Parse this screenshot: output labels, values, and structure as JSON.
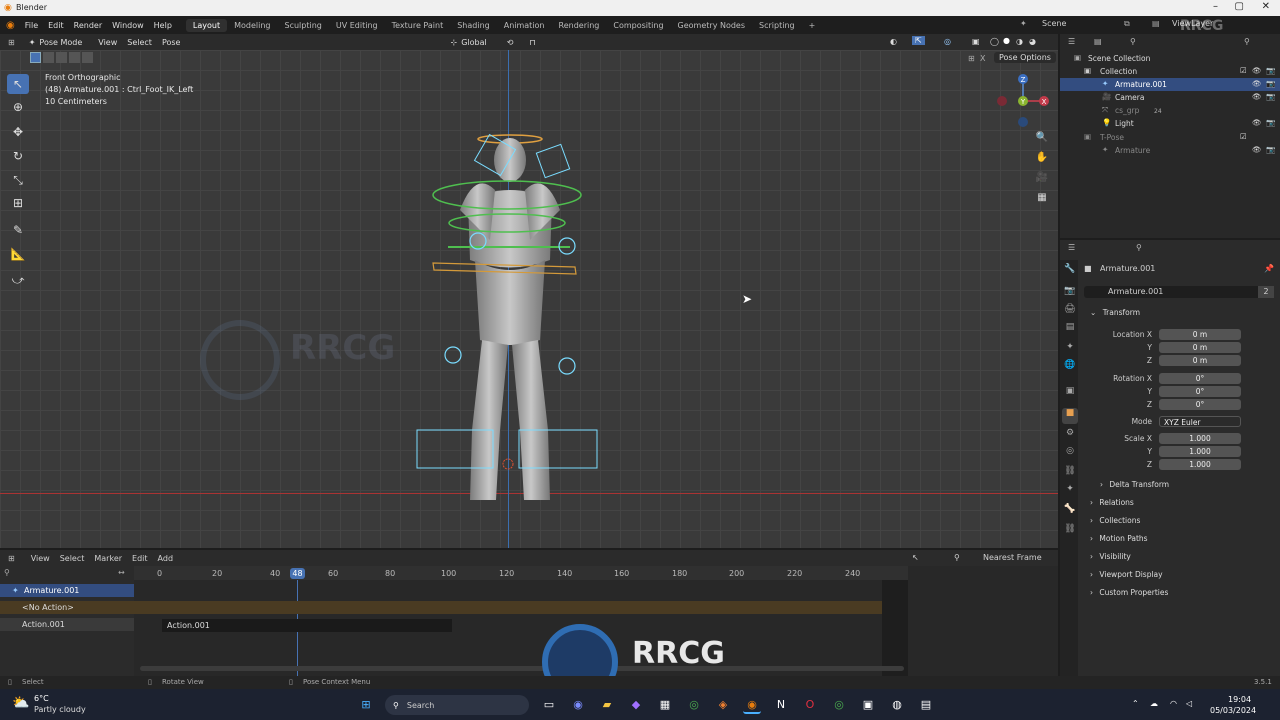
{
  "window": {
    "title": "Blender"
  },
  "menu": {
    "items": [
      "File",
      "Edit",
      "Render",
      "Window",
      "Help"
    ]
  },
  "workspaces": [
    "Layout",
    "Modeling",
    "Sculpting",
    "UV Editing",
    "Texture Paint",
    "Shading",
    "Animation",
    "Rendering",
    "Compositing",
    "Geometry Nodes",
    "Scripting"
  ],
  "workspace_add": "+",
  "scene": {
    "name": "Scene",
    "view_layer": "ViewLayer"
  },
  "viewport": {
    "mode": "Pose Mode",
    "menus": [
      "View",
      "Select",
      "Pose"
    ],
    "orientation": "Global",
    "pose_options": "Pose Options",
    "view_name": "Front Orthographic",
    "active_info": "(48) Armature.001 : Ctrl_Foot_IK_Left",
    "scale_info": "10 Centimeters",
    "axis_labels": {
      "z": "Z",
      "y": "Y",
      "x": "X"
    }
  },
  "timeline": {
    "menus": [
      "View",
      "Select",
      "Marker",
      "Edit",
      "Add"
    ],
    "snap": "Nearest Frame",
    "current_frame": "48",
    "ruler": [
      "0",
      "20",
      "40",
      "60",
      "80",
      "100",
      "120",
      "140",
      "160",
      "180",
      "200",
      "220",
      "240"
    ],
    "channels": [
      "Armature.001",
      "<No Action>",
      "Action.001"
    ],
    "strip": "Action.001"
  },
  "outliner": {
    "rows": [
      "Scene Collection",
      "Collection",
      "Armature.001",
      "Camera",
      "cs_grp",
      "Light",
      "T-Pose",
      "Armature"
    ],
    "badge": "24"
  },
  "properties": {
    "object_name": "Armature.001",
    "data_name": "Armature.001",
    "users": "2",
    "transform_title": "Transform",
    "location": {
      "label": "Location X",
      "x": "0 m",
      "y": "0 m",
      "z": "0 m"
    },
    "rotation": {
      "label": "Rotation X",
      "x": "0°",
      "y": "0°",
      "z": "0°"
    },
    "mode_label": "Mode",
    "mode_value": "XYZ Euler",
    "scale": {
      "label": "Scale X",
      "x": "1.000",
      "y": "1.000",
      "z": "1.000"
    },
    "axis_y": "Y",
    "axis_z": "Z",
    "panels": [
      "Delta Transform",
      "Relations",
      "Collections",
      "Motion Paths",
      "Visibility",
      "Viewport Display",
      "Custom Properties"
    ]
  },
  "statusbar": {
    "left": "Select",
    "middle": "Rotate View",
    "right": "Pose Context Menu",
    "version": "3.5.1"
  },
  "taskbar": {
    "weather_temp": "6°C",
    "weather_desc": "Partly cloudy",
    "search": "Search",
    "time": "19:04",
    "date": "05/03/2024"
  },
  "watermark": "RRCG"
}
